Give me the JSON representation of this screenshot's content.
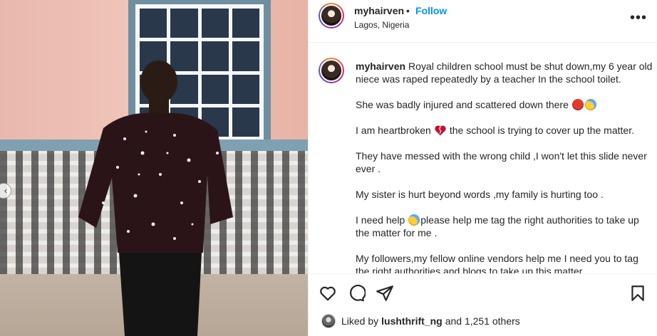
{
  "post": {
    "username": "myhairven",
    "dot": "•",
    "follow_label": "Follow",
    "location": "Lagos, Nigeria",
    "more_label": "•••"
  },
  "caption": {
    "username": "myhairven",
    "paragraphs": [
      "Royal children school must be shut down,my 6 year old niece was raped repeatedly by a teacher In the school toilet.",
      "She was badly injured and scattered down there",
      "I am heartbroken",
      "the school is trying to cover up the matter.",
      "They have messed with the wrong child ,I won't let this slide never ever .",
      "My sister is hurt beyond words ,my family is hurting too .",
      "I need help",
      "please help me tag the right authorities to take up the matter for me .",
      "My followers,my fellow online vendors help me I need you to tag the right authorities and blogs to take up this matter."
    ]
  },
  "likes": {
    "prefix": "Liked by",
    "user": "lushthrift_ng",
    "suffix": "and 1,251 others"
  },
  "icons": {
    "like": "heart-outline-icon",
    "comment": "comment-bubble-icon",
    "share": "paper-plane-icon",
    "save": "bookmark-icon",
    "more": "ellipsis-icon",
    "carousel_prev": "chevron-left-icon"
  },
  "colors": {
    "accent": "#0095f6",
    "text": "#262626",
    "divider": "#efefef"
  }
}
